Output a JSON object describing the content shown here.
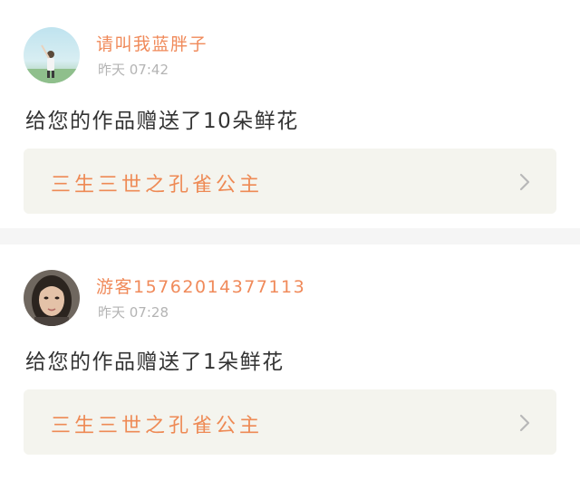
{
  "colors": {
    "username": "#f08a5a",
    "time": "#b4b4b4",
    "message": "#333333",
    "work_title": "#ee8a55",
    "work_bg": "#f4f4ee",
    "page_bg": "#f5f5f5"
  },
  "notifications": [
    {
      "avatar": "avatar-landscape-girl",
      "username": "请叫我蓝胖子",
      "time": "昨天 07:42",
      "message": "给您的作品赠送了10朵鲜花",
      "work_title": "三生三世之孔雀公主",
      "chevron_icon": "chevron-right-icon"
    },
    {
      "avatar": "avatar-portrait-woman",
      "username": "游客15762014377113",
      "time": "昨天 07:28",
      "message": "给您的作品赠送了1朵鲜花",
      "work_title": "三生三世之孔雀公主",
      "chevron_icon": "chevron-right-icon"
    }
  ]
}
